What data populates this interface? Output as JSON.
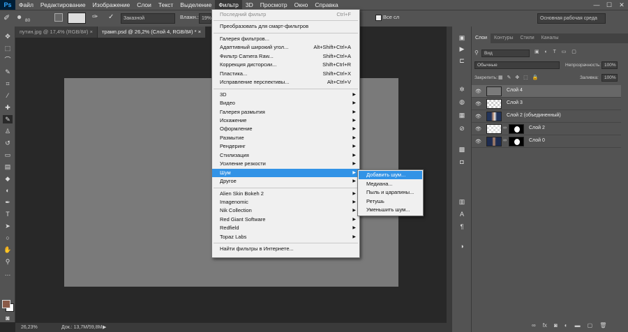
{
  "app": {
    "logo": "Ps"
  },
  "menubar": {
    "items": [
      "Файл",
      "Редактирование",
      "Изображение",
      "Слои",
      "Текст",
      "Выделение",
      "Фильтр",
      "3D",
      "Просмотр",
      "Окно",
      "Справка"
    ],
    "active": "Фильтр"
  },
  "options": {
    "brush_size": "80",
    "blend_mode": "Заказной",
    "opacity_label": "Влажн.:",
    "opacity_value": "19%",
    "all_layers_label": "Все сл",
    "workspace": "Основная рабочая среда"
  },
  "doc_tabs": [
    {
      "label": "путин.jpg @ 17,4% (RGB/8#)",
      "close": "×"
    },
    {
      "label": "трамп.psd @ 26,2% (Слой 4, RGB/8#) *",
      "close": "×"
    }
  ],
  "status": {
    "zoom": "26,23%",
    "doc": "Док.: 13,7M/59,8M"
  },
  "filter_menu": {
    "items": [
      {
        "label": "Последний фильтр",
        "shortcut": "Ctrl+F",
        "disabled": true
      },
      {
        "sep": true
      },
      {
        "label": "Преобразовать для смарт-фильтров"
      },
      {
        "sep": true
      },
      {
        "label": "Галерея фильтров..."
      },
      {
        "label": "Адаптивный широкий угол...",
        "shortcut": "Alt+Shift+Ctrl+A"
      },
      {
        "label": "Фильтр Camera Raw...",
        "shortcut": "Shift+Ctrl+A"
      },
      {
        "label": "Коррекция дисторсии...",
        "shortcut": "Shift+Ctrl+R"
      },
      {
        "label": "Пластика...",
        "shortcut": "Shift+Ctrl+X"
      },
      {
        "label": "Исправление перспективы...",
        "shortcut": "Alt+Ctrl+V"
      },
      {
        "sep": true
      },
      {
        "label": "3D",
        "arrow": true
      },
      {
        "label": "Видео",
        "arrow": true
      },
      {
        "label": "Галерея размытия",
        "arrow": true
      },
      {
        "label": "Искажение",
        "arrow": true
      },
      {
        "label": "Оформление",
        "arrow": true
      },
      {
        "label": "Размытие",
        "arrow": true
      },
      {
        "label": "Рендеринг",
        "arrow": true
      },
      {
        "label": "Стилизация",
        "arrow": true
      },
      {
        "label": "Усиление резкости",
        "arrow": true
      },
      {
        "label": "Шум",
        "arrow": true,
        "highlight": true
      },
      {
        "label": "Другое",
        "arrow": true
      },
      {
        "sep": true
      },
      {
        "label": "Alien Skin Bokeh 2",
        "arrow": true
      },
      {
        "label": "Imagenomic",
        "arrow": true
      },
      {
        "label": "Nik Collection",
        "arrow": true
      },
      {
        "label": "Red Giant Software",
        "arrow": true
      },
      {
        "label": "Redfield",
        "arrow": true
      },
      {
        "label": "Topaz Labs",
        "arrow": true
      },
      {
        "sep": true
      },
      {
        "label": "Найти фильтры в Интернете..."
      }
    ]
  },
  "noise_submenu": {
    "items": [
      "Добавить шум...",
      "Медиана...",
      "Пыль и царапины...",
      "Ретушь",
      "Уменьшить шум..."
    ],
    "highlight": 0
  },
  "layers_panel": {
    "tabs": [
      "Слои",
      "Контуры",
      "Стили",
      "Каналы"
    ],
    "kind": "Вид",
    "blend": "Обычные",
    "opacity_label": "Непрозрачность:",
    "opacity": "100%",
    "lock_label": "Закрепить:",
    "fill_label": "Заливка:",
    "fill": "100%",
    "layers": [
      {
        "name": "Слой 4",
        "selected": true,
        "thumb": "gray"
      },
      {
        "name": "Слой 3",
        "thumb": "checker"
      },
      {
        "name": "Слой 2 (объединенный)",
        "thumb": "photo"
      },
      {
        "name": "Слой 2",
        "thumb": "checker2",
        "mask": true
      },
      {
        "name": "Слой 0",
        "thumb": "photo2",
        "mask": true
      }
    ],
    "footer_icons": [
      "link-icon",
      "fx-icon",
      "mask-icon",
      "adjust-icon",
      "folder-icon",
      "new-layer-icon",
      "trash-icon"
    ]
  },
  "colors": {
    "accent": "#3293e6",
    "panel": "#535353",
    "canvas": "#7a7a7a",
    "fg_swatch": "#8a5a48"
  }
}
